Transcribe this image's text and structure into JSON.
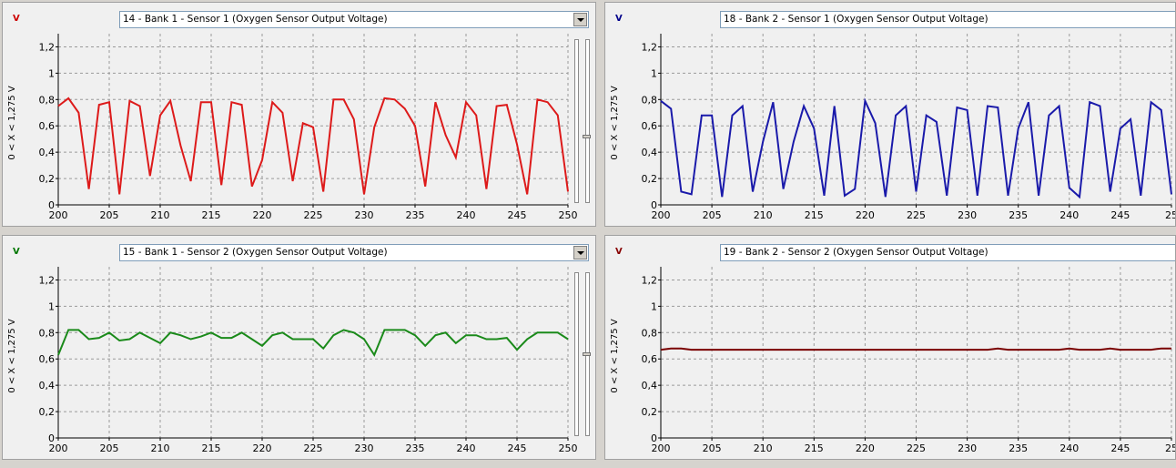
{
  "panels": [
    {
      "id": "p1",
      "unit": "V",
      "unit_color": "#cc0000",
      "selector_text": "14 - Bank 1 - Sensor 1 (Oxygen Sensor Output Voltage)",
      "line_color": "#dd1a1a",
      "chart_data": {
        "type": "line",
        "ylabel": "0  < X <  1,275  V",
        "xlim": [
          200,
          250
        ],
        "ylim": [
          0,
          1.3
        ],
        "x_ticks": [
          "200",
          "205",
          "210",
          "215",
          "220",
          "225",
          "230",
          "235",
          "240",
          "245",
          "250"
        ],
        "y_ticks": [
          "0",
          "0,2",
          "0,4",
          "0,6",
          "0,8",
          "1",
          "1,2"
        ],
        "grid": true,
        "series": [
          {
            "x": [
              200,
              201,
              202,
              203,
              204,
              205,
              206,
              207,
              208,
              209,
              210,
              211,
              212,
              213,
              214,
              215,
              216,
              217,
              218,
              219,
              220,
              221,
              222,
              223,
              224,
              225,
              226,
              227,
              228,
              229,
              230,
              231,
              232,
              233,
              234,
              235,
              236,
              237,
              238,
              239,
              240,
              241,
              242,
              243,
              244,
              245,
              246,
              247,
              248,
              249,
              250
            ],
            "values": [
              0.75,
              0.81,
              0.7,
              0.12,
              0.76,
              0.78,
              0.08,
              0.79,
              0.75,
              0.22,
              0.68,
              0.79,
              0.45,
              0.18,
              0.78,
              0.78,
              0.15,
              0.78,
              0.76,
              0.14,
              0.34,
              0.78,
              0.7,
              0.18,
              0.62,
              0.59,
              0.1,
              0.8,
              0.8,
              0.65,
              0.08,
              0.59,
              0.81,
              0.8,
              0.73,
              0.6,
              0.14,
              0.78,
              0.53,
              0.36,
              0.78,
              0.68,
              0.12,
              0.75,
              0.76,
              0.46,
              0.08,
              0.8,
              0.78,
              0.68,
              0.1
            ]
          }
        ]
      }
    },
    {
      "id": "p2",
      "unit": "V",
      "unit_color": "#00008b",
      "selector_text": "18 - Bank 2 - Sensor 1 (Oxygen Sensor Output Voltage)",
      "line_color": "#1a1aaa",
      "chart_data": {
        "type": "line",
        "ylabel": "0  < X <  1,275  V",
        "xlim": [
          200,
          250
        ],
        "ylim": [
          0,
          1.3
        ],
        "x_ticks": [
          "200",
          "205",
          "210",
          "215",
          "220",
          "225",
          "230",
          "235",
          "240",
          "245",
          "25"
        ],
        "y_ticks": [
          "0",
          "0,2",
          "0,4",
          "0,6",
          "0,8",
          "1",
          "1,2"
        ],
        "grid": true,
        "series": [
          {
            "x": [
              200,
              201,
              202,
              203,
              204,
              205,
              206,
              207,
              208,
              209,
              210,
              211,
              212,
              213,
              214,
              215,
              216,
              217,
              218,
              219,
              220,
              221,
              222,
              223,
              224,
              225,
              226,
              227,
              228,
              229,
              230,
              231,
              232,
              233,
              234,
              235,
              236,
              237,
              238,
              239,
              240,
              241,
              242,
              243,
              244,
              245,
              246,
              247,
              248,
              249,
              250
            ],
            "values": [
              0.79,
              0.73,
              0.1,
              0.08,
              0.68,
              0.68,
              0.06,
              0.68,
              0.75,
              0.1,
              0.48,
              0.78,
              0.12,
              0.48,
              0.75,
              0.58,
              0.07,
              0.75,
              0.07,
              0.12,
              0.79,
              0.62,
              0.06,
              0.68,
              0.75,
              0.1,
              0.68,
              0.63,
              0.07,
              0.74,
              0.72,
              0.07,
              0.75,
              0.74,
              0.07,
              0.58,
              0.78,
              0.07,
              0.68,
              0.75,
              0.13,
              0.06,
              0.78,
              0.75,
              0.1,
              0.58,
              0.65,
              0.07,
              0.78,
              0.72,
              0.08
            ]
          }
        ]
      }
    },
    {
      "id": "p3",
      "unit": "V",
      "unit_color": "#007700",
      "selector_text": "15 - Bank 1 - Sensor 2 (Oxygen Sensor Output Voltage)",
      "line_color": "#1a8a1a",
      "chart_data": {
        "type": "line",
        "ylabel": "0  < X <  1,275  V",
        "xlim": [
          200,
          250
        ],
        "ylim": [
          0,
          1.3
        ],
        "x_ticks": [
          "200",
          "205",
          "210",
          "215",
          "220",
          "225",
          "230",
          "235",
          "240",
          "245",
          "250"
        ],
        "y_ticks": [
          "0",
          "0,2",
          "0,4",
          "0,6",
          "0,8",
          "1",
          "1,2"
        ],
        "grid": true,
        "series": [
          {
            "x": [
              200,
              201,
              202,
              203,
              204,
              205,
              206,
              207,
              208,
              209,
              210,
              211,
              212,
              213,
              214,
              215,
              216,
              217,
              218,
              219,
              220,
              221,
              222,
              223,
              224,
              225,
              226,
              227,
              228,
              229,
              230,
              231,
              232,
              233,
              234,
              235,
              236,
              237,
              238,
              239,
              240,
              241,
              242,
              243,
              244,
              245,
              246,
              247,
              248,
              249,
              250
            ],
            "values": [
              0.63,
              0.82,
              0.82,
              0.75,
              0.76,
              0.8,
              0.74,
              0.75,
              0.8,
              0.76,
              0.72,
              0.8,
              0.78,
              0.75,
              0.77,
              0.8,
              0.76,
              0.76,
              0.8,
              0.75,
              0.7,
              0.78,
              0.8,
              0.75,
              0.75,
              0.75,
              0.68,
              0.78,
              0.82,
              0.8,
              0.75,
              0.63,
              0.82,
              0.82,
              0.82,
              0.78,
              0.7,
              0.78,
              0.8,
              0.72,
              0.78,
              0.78,
              0.75,
              0.75,
              0.76,
              0.67,
              0.75,
              0.8,
              0.8,
              0.8,
              0.75
            ]
          }
        ]
      }
    },
    {
      "id": "p4",
      "unit": "V",
      "unit_color": "#880000",
      "selector_text": "19 - Bank 2 - Sensor 2 (Oxygen Sensor Output Voltage)",
      "line_color": "#7a0000",
      "chart_data": {
        "type": "line",
        "ylabel": "0  < X <  1,275  V",
        "xlim": [
          200,
          250
        ],
        "ylim": [
          0,
          1.3
        ],
        "x_ticks": [
          "200",
          "205",
          "210",
          "215",
          "220",
          "225",
          "230",
          "235",
          "240",
          "245",
          "25"
        ],
        "y_ticks": [
          "0",
          "0,2",
          "0,4",
          "0,6",
          "0,8",
          "1",
          "1,2"
        ],
        "grid": true,
        "series": [
          {
            "x": [
              200,
              201,
              202,
              203,
              204,
              205,
              206,
              207,
              208,
              209,
              210,
              211,
              212,
              213,
              214,
              215,
              216,
              217,
              218,
              219,
              220,
              221,
              222,
              223,
              224,
              225,
              226,
              227,
              228,
              229,
              230,
              231,
              232,
              233,
              234,
              235,
              236,
              237,
              238,
              239,
              240,
              241,
              242,
              243,
              244,
              245,
              246,
              247,
              248,
              249,
              250
            ],
            "values": [
              0.67,
              0.68,
              0.68,
              0.67,
              0.67,
              0.67,
              0.67,
              0.67,
              0.67,
              0.67,
              0.67,
              0.67,
              0.67,
              0.67,
              0.67,
              0.67,
              0.67,
              0.67,
              0.67,
              0.67,
              0.67,
              0.67,
              0.67,
              0.67,
              0.67,
              0.67,
              0.67,
              0.67,
              0.67,
              0.67,
              0.67,
              0.67,
              0.67,
              0.68,
              0.67,
              0.67,
              0.67,
              0.67,
              0.67,
              0.67,
              0.68,
              0.67,
              0.67,
              0.67,
              0.68,
              0.67,
              0.67,
              0.67,
              0.67,
              0.68,
              0.68
            ]
          }
        ]
      }
    }
  ]
}
